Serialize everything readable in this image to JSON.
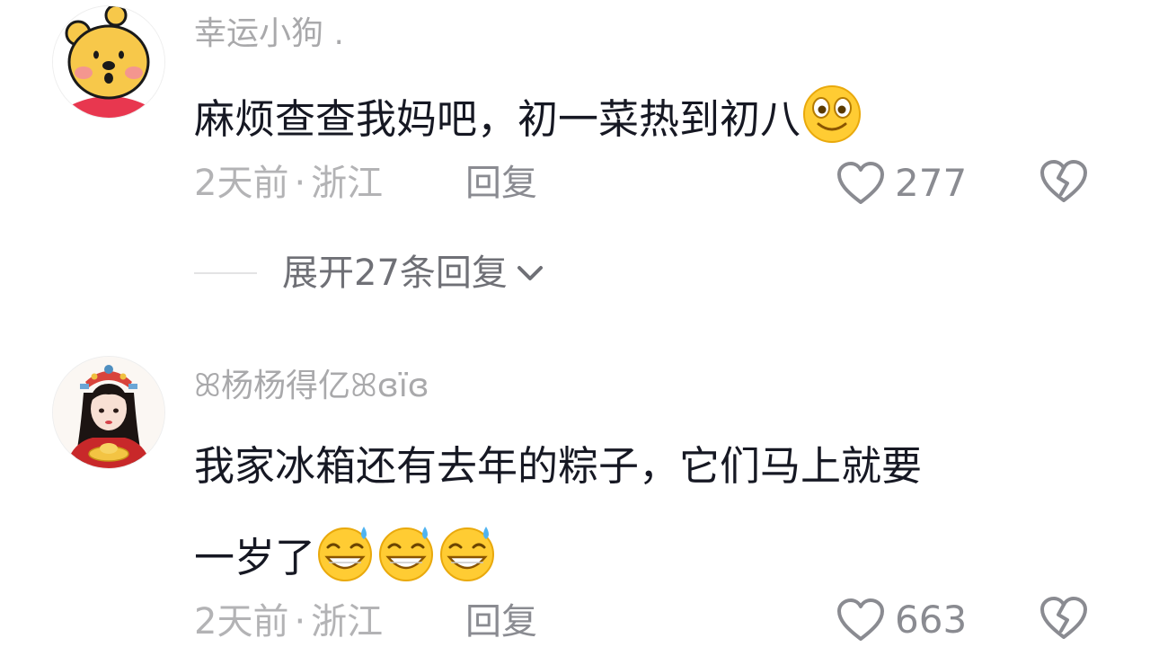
{
  "comments": [
    {
      "username": "幸运小狗 .",
      "text": "麻烦查查我妈吧，初一菜热到初八",
      "emoji_icons": [
        "smiling-face-emoji"
      ],
      "time": "2天前",
      "separator": "·",
      "location": "浙江",
      "reply_label": "回复",
      "likes": "277",
      "expand_replies_label": "展开27条回复"
    },
    {
      "username": "ꕤ杨杨得亿ꕤɞïɞ",
      "text_line1": "我家冰箱还有去年的粽子，它们马上就要",
      "text_line2": "一岁了",
      "emoji_icons": [
        "grinning-sweat-emoji",
        "grinning-sweat-emoji",
        "grinning-sweat-emoji"
      ],
      "time": "2天前",
      "separator": "·",
      "location": "浙江",
      "reply_label": "回复",
      "likes": "663"
    }
  ],
  "icons": {
    "like": "heart-outline-icon",
    "dislike": "broken-heart-icon",
    "expand": "chevron-down-icon"
  },
  "colors": {
    "text_primary": "#161823",
    "text_secondary": "#a9a9ab",
    "action": "#8a8b91"
  }
}
